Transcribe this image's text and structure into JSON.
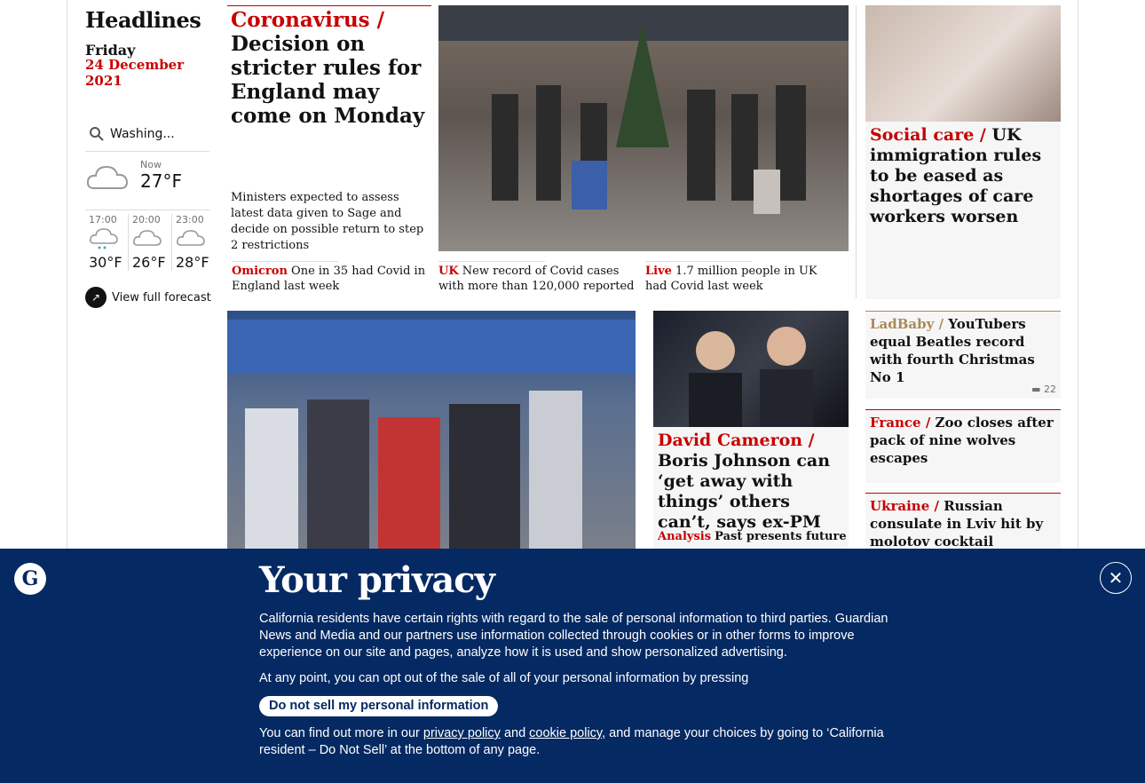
{
  "rail": {
    "title": "Headlines",
    "day": "Friday",
    "date": "24 December 2021",
    "search_value": "Washing...",
    "now_label": "Now",
    "now_temp": "27°F",
    "hours": [
      {
        "time": "17:00",
        "temp": "30°F"
      },
      {
        "time": "20:00",
        "temp": "26°F"
      },
      {
        "time": "23:00",
        "temp": "28°F"
      }
    ],
    "forecast_label": "View full forecast"
  },
  "lead": {
    "kicker": "Coronavirus /",
    "headline": "Decision on stricter rules for England may come on Monday",
    "standfirst": "Ministers expected to assess latest data given to Sage and decide on possible return to step 2 restrictions"
  },
  "sublinks": [
    {
      "kicker": "Omicron",
      "text": "One in 35 had Covid in England last week"
    },
    {
      "kicker": "UK",
      "text": "New record of Covid cases with more than 120,000 reported"
    },
    {
      "kicker": "Live",
      "text": "1.7 million people in UK had Covid last week"
    }
  ],
  "social_care": {
    "kicker": "Social care /",
    "text": "UK immigration rules to be eased as shortages of care workers worsen"
  },
  "ladbaby": {
    "kicker": "LadBaby /",
    "text": "YouTubers equal Beatles record with fourth Christmas No 1",
    "comments": "22"
  },
  "france": {
    "kicker": "France /",
    "text": "Zoo closes after pack of nine wolves escapes"
  },
  "ukraine": {
    "kicker": "Ukraine /",
    "text": "Russian consulate in Lviv hit by molotov cocktail"
  },
  "cameron": {
    "kicker": "David Cameron /",
    "text": "Boris Johnson can ‘get away with things’ others can’t, says ex-PM",
    "sub_kicker": "Analysis",
    "sub_text": "Past presents future"
  },
  "privacy": {
    "title": "Your privacy",
    "p1": "California residents have certain rights with regard to the sale of personal information to third parties. Guardian News and Media and our partners use information collected through cookies or in other forms to improve experience on our site and pages, analyze how it is used and show personalized advertising.",
    "p2": "At any point, you can opt out of the sale of all of your personal information by pressing",
    "optout_label": "Do not sell my personal information",
    "p3a": "You can find out more in our",
    "privacy_policy": "privacy policy",
    "and": "and",
    "cookie_policy": "cookie policy",
    "p3b": ", and manage your choices by going to ‘California resident – Do Not Sell’ at the bottom of any page.",
    "close_icon": "close-icon"
  }
}
